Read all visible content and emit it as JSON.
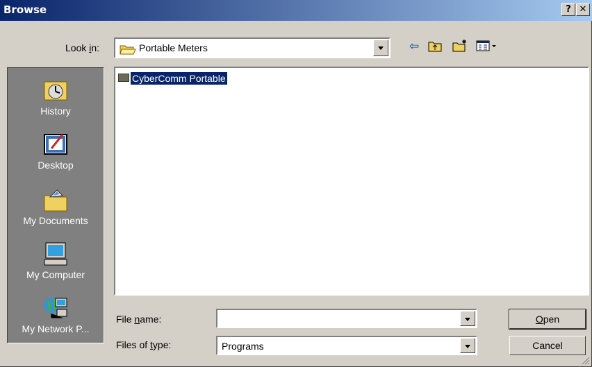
{
  "window": {
    "title": "Browse",
    "help_label": "?",
    "close_label": "✕"
  },
  "lookin": {
    "label_pre": "Look ",
    "label_u": "i",
    "label_post": "n:",
    "value": "Portable Meters"
  },
  "places": [
    {
      "label": "History",
      "icon": "history-icon"
    },
    {
      "label": "Desktop",
      "icon": "desktop-icon"
    },
    {
      "label": "My Documents",
      "icon": "my-documents-icon"
    },
    {
      "label": "My Computer",
      "icon": "my-computer-icon"
    },
    {
      "label": "My Network P...",
      "icon": "my-network-places-icon"
    }
  ],
  "files": [
    {
      "name": "CyberComm Portable",
      "type": "folder",
      "selected": true
    }
  ],
  "filename": {
    "label_pre": "File ",
    "label_u": "n",
    "label_post": "ame:",
    "value": ""
  },
  "filetype": {
    "label_pre": "Files of ",
    "label_u": "t",
    "label_post": "ype:",
    "value": "Programs"
  },
  "buttons": {
    "open_u": "O",
    "open_rest": "pen",
    "cancel": "Cancel"
  },
  "toolbar": {
    "back": "⇦",
    "up": "up-folder-icon",
    "new": "new-folder-icon",
    "view": "view-menu-icon"
  }
}
